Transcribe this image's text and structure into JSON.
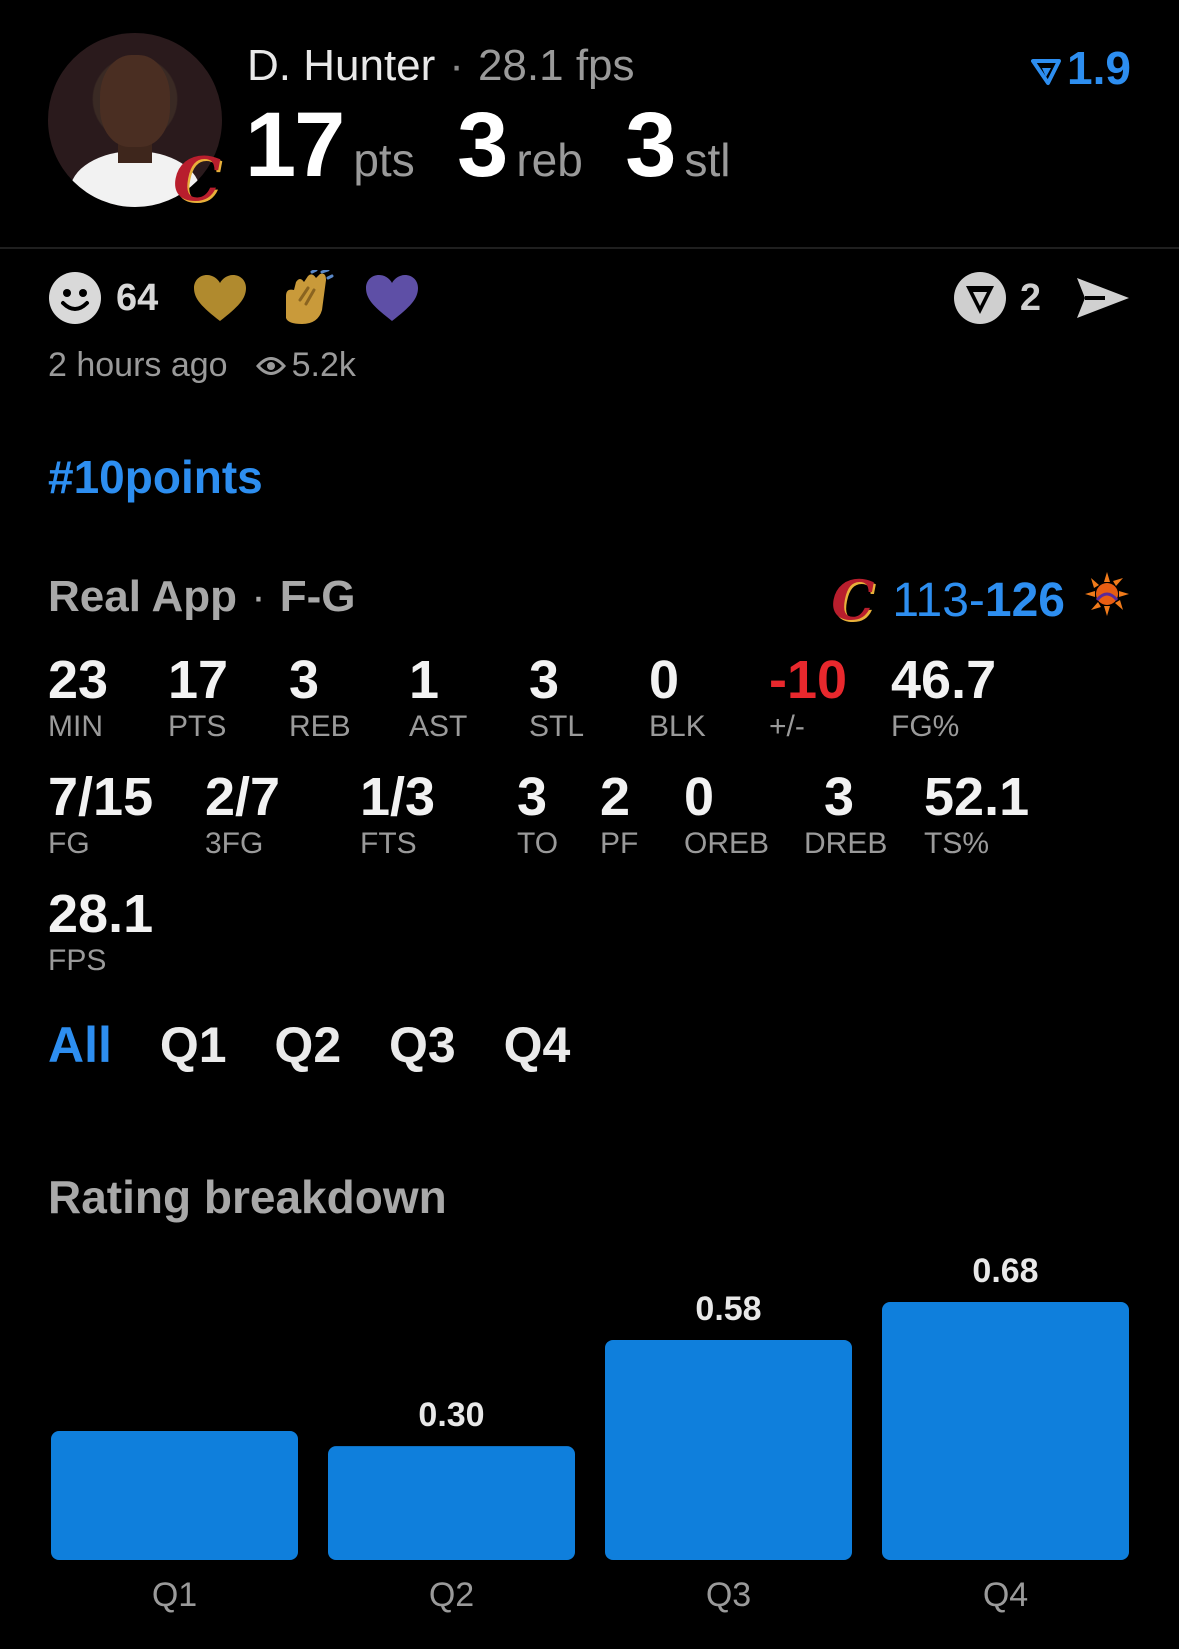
{
  "header": {
    "player_name": "D. Hunter",
    "separator": "·",
    "fps_text": "28.1 fps",
    "rating": "1.9",
    "big_stats": [
      {
        "value": "17",
        "unit": "pts"
      },
      {
        "value": "3",
        "unit": "reb"
      },
      {
        "value": "3",
        "unit": "stl"
      }
    ]
  },
  "reactions": {
    "smile_count": "64",
    "icons": [
      "smile-icon",
      "gold-heart-icon",
      "clap-icon",
      "purple-heart-icon"
    ],
    "comment_count": "2"
  },
  "meta": {
    "time_ago": "2 hours ago",
    "views": "5.2k"
  },
  "hashtag": "#10points",
  "game": {
    "source": "Real App",
    "separator": "·",
    "position": "F-G",
    "score_home": "113",
    "score_dash": "-",
    "score_away": "126"
  },
  "stats": {
    "row1": [
      {
        "value": "23",
        "label": "MIN"
      },
      {
        "value": "17",
        "label": "PTS"
      },
      {
        "value": "3",
        "label": "REB"
      },
      {
        "value": "1",
        "label": "AST"
      },
      {
        "value": "3",
        "label": "STL"
      },
      {
        "value": "0",
        "label": "BLK"
      },
      {
        "value": "-10",
        "label": "+/-"
      },
      {
        "value": "46.7",
        "label": "FG%"
      }
    ],
    "row2": [
      {
        "value": "7/15",
        "label": "FG"
      },
      {
        "value": "2/7",
        "label": "3FG"
      },
      {
        "value": "1/3",
        "label": "FTS"
      },
      {
        "value": "3",
        "label": "TO"
      },
      {
        "value": "2",
        "label": "PF"
      },
      {
        "value": "0",
        "label": "OREB"
      },
      {
        "value": "3",
        "label": "DREB"
      },
      {
        "value": "52.1",
        "label": "TS%"
      }
    ],
    "row3": [
      {
        "value": "28.1",
        "label": "FPS"
      }
    ]
  },
  "tabs": [
    "All",
    "Q1",
    "Q2",
    "Q3",
    "Q4"
  ],
  "section_title": "Rating breakdown",
  "colors": {
    "accent": "#2d8ef0",
    "bar": "#0f7fdc",
    "negative": "#e8282d",
    "background": "#000000"
  },
  "chart_data": {
    "type": "bar",
    "title": "Rating breakdown",
    "categories": [
      "Q1",
      "Q2",
      "Q3",
      "Q4"
    ],
    "values": [
      0.34,
      0.3,
      0.58,
      0.68
    ],
    "value_labels": [
      "",
      "0.30",
      "0.58",
      "0.68"
    ],
    "ylim": [
      0,
      0.68
    ],
    "grid": false,
    "legend": "none"
  }
}
